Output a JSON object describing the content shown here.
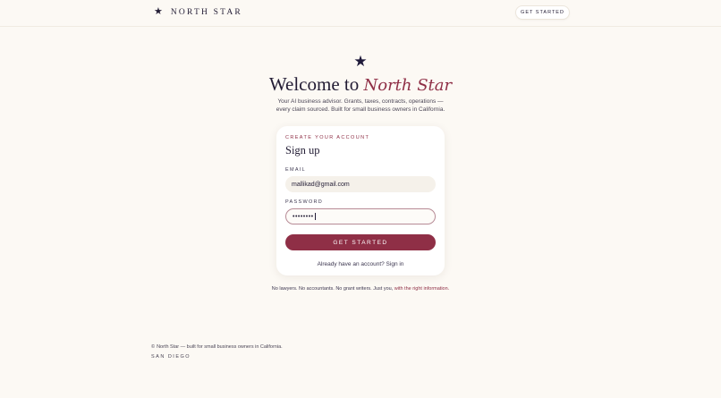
{
  "header": {
    "brand_icon": "star-icon",
    "brand_name": "NORTH STAR",
    "cta_label": "GET STARTED"
  },
  "hero": {
    "icon": "star-icon",
    "welcome_prefix": "Welcome to ",
    "welcome_accent": "North Star",
    "subtitle_line1": "Your AI business advisor. Grants, taxes, contracts, operations —",
    "subtitle_line2": "every claim sourced. Built for small business owners in California."
  },
  "form": {
    "eyebrow": "CREATE YOUR ACCOUNT",
    "title": "Sign up",
    "email_label": "EMAIL",
    "email_value": "mallikad@gmail.com",
    "password_label": "PASSWORD",
    "password_value": "••••••••",
    "submit_label": "GET STARTED",
    "signin_prompt": "Already have an account? ",
    "signin_link": "Sign in"
  },
  "tagline": {
    "text": "No lawyers. No accountants. No grant writers. Just you, ",
    "accent": "with the right information."
  },
  "footer": {
    "copyright_symbol": "©",
    "text": "North Star — built for small business owners in California.",
    "city": "SAN DIEGO"
  },
  "colors": {
    "background": "#fcf9f4",
    "brand_dark": "#231d35",
    "accent": "#8f2f46"
  }
}
